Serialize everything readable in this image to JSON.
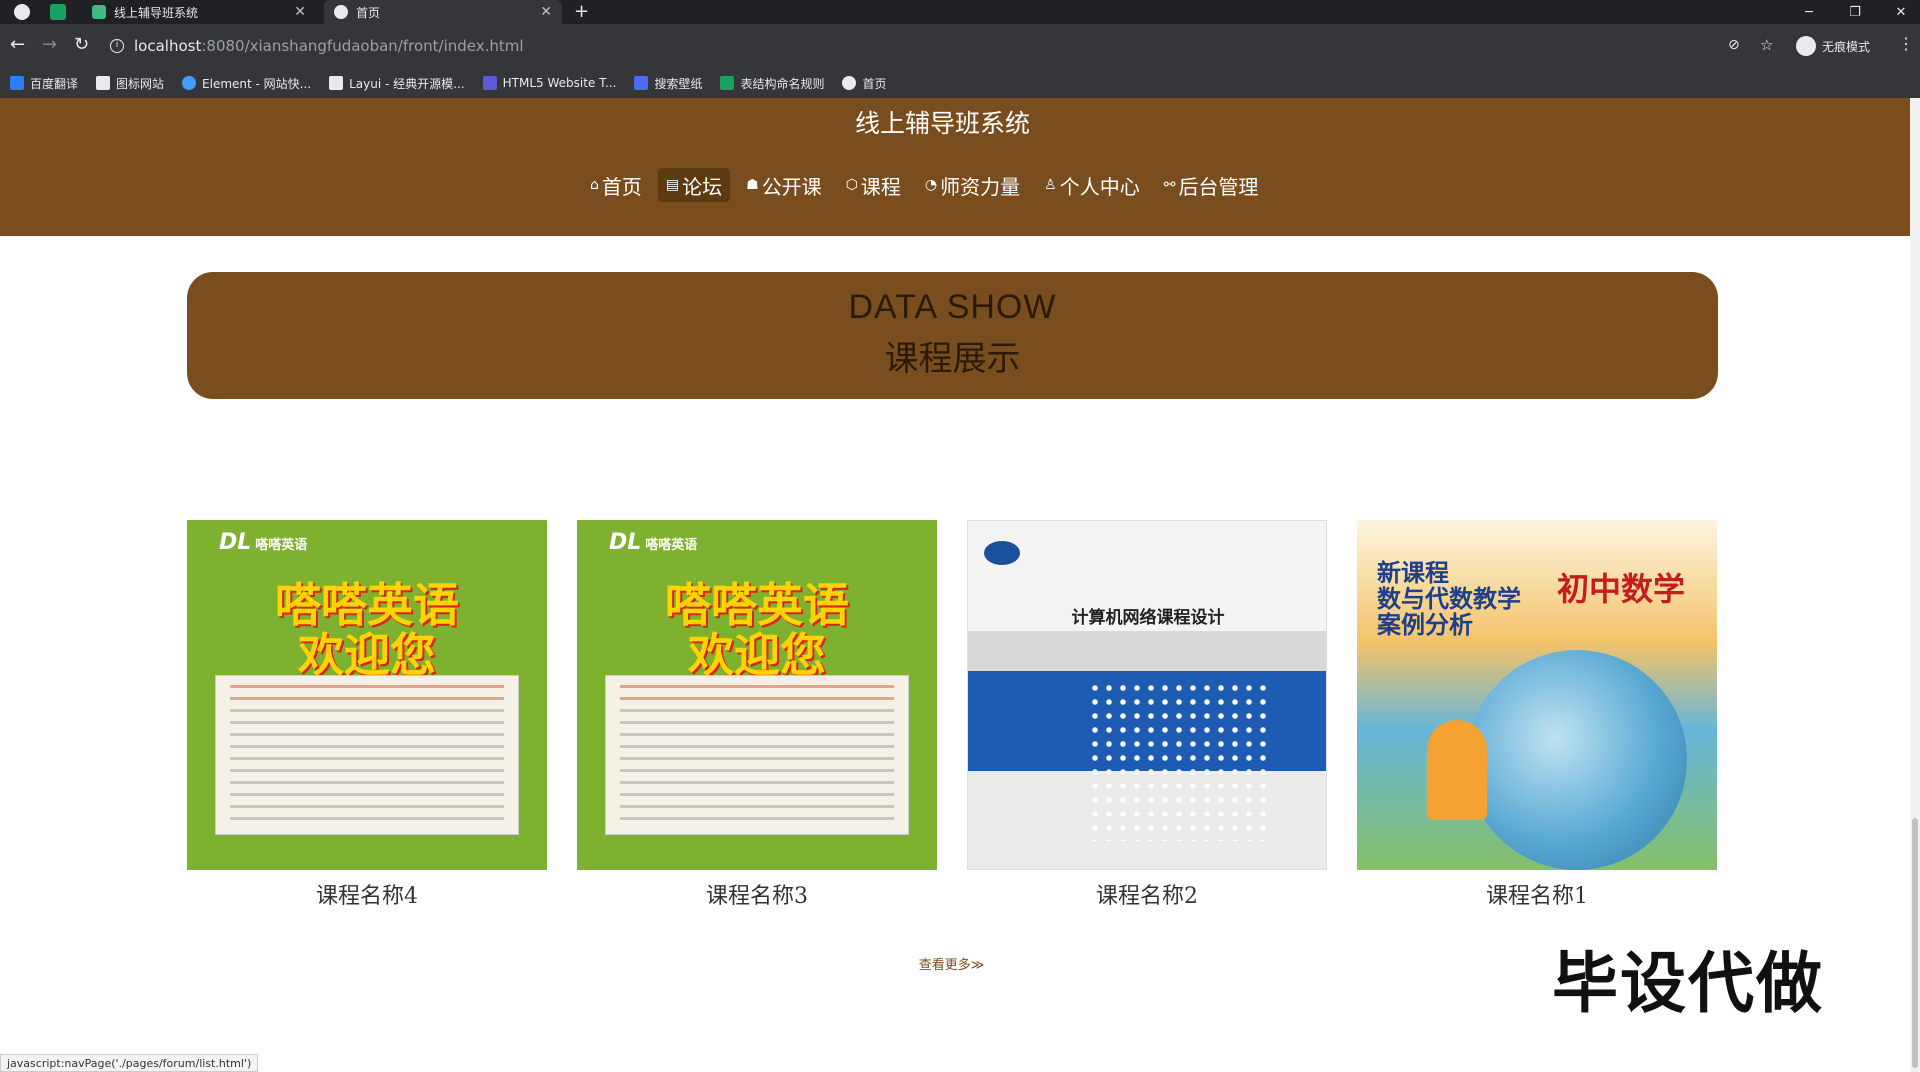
{
  "browser": {
    "tabs": [
      {
        "title": "线上辅导班系统",
        "icon_color": "#42b983"
      },
      {
        "title": "首页",
        "icon_color": "#e8eaed"
      }
    ],
    "url_host": "localhost",
    "url_rest": ":8080/xianshangfudaoban/front/index.html",
    "incognito_label": "无痕模式",
    "bookmarks": [
      {
        "label": "百度翻译",
        "color": "#2f7cf6"
      },
      {
        "label": "图标网站",
        "color": "#e8eaed"
      },
      {
        "label": "Element - 网站快...",
        "color": "#409eff"
      },
      {
        "label": "Layui - 经典开源模...",
        "color": "#e8eaed"
      },
      {
        "label": "HTML5 Website T...",
        "color": "#5b5bd6"
      },
      {
        "label": "搜索壁纸",
        "color": "#4a6cf7"
      },
      {
        "label": "表结构命名规则",
        "color": "#19a15f"
      },
      {
        "label": "首页",
        "color": "#e8eaed"
      }
    ]
  },
  "site": {
    "title": "线上辅导班系统",
    "accent": "#7a4d1e"
  },
  "nav": [
    {
      "icon": "home-icon",
      "glyph": "⌂",
      "label": "首页"
    },
    {
      "icon": "forum-icon",
      "glyph": "▤",
      "label": "论坛"
    },
    {
      "icon": "graduation-cap-icon",
      "glyph": "☗",
      "label": "公开课"
    },
    {
      "icon": "course-icon",
      "glyph": "⬡",
      "label": "课程"
    },
    {
      "icon": "power-icon",
      "glyph": "◔",
      "label": "师资力量"
    },
    {
      "icon": "user-icon",
      "glyph": "♙",
      "label": "个人中心"
    },
    {
      "icon": "link-icon",
      "glyph": "⚯",
      "label": "后台管理"
    }
  ],
  "banner": {
    "en": "DATA SHOW",
    "zh": "课程展示"
  },
  "courses": [
    {
      "name": "课程名称4",
      "cover": "english-poster"
    },
    {
      "name": "课程名称3",
      "cover": "english-poster"
    },
    {
      "name": "课程名称2",
      "cover": "network-book"
    },
    {
      "name": "课程名称1",
      "cover": "math-book"
    }
  ],
  "covers": {
    "english": {
      "logo": "DL",
      "logo_sub": "嗒嗒英语",
      "headline_1": "嗒嗒英语",
      "headline_2": "欢迎您"
    },
    "network": {
      "title": "计算机网络课程设计"
    },
    "math": {
      "line_1": "新课程",
      "line_2": "数与代数教学",
      "line_3": "案例分析",
      "subject": "初中数学"
    }
  },
  "more_link": "查看更多≫",
  "watermark": "毕设代做",
  "status_url": "javascript:navPage('./pages/forum/list.html')"
}
